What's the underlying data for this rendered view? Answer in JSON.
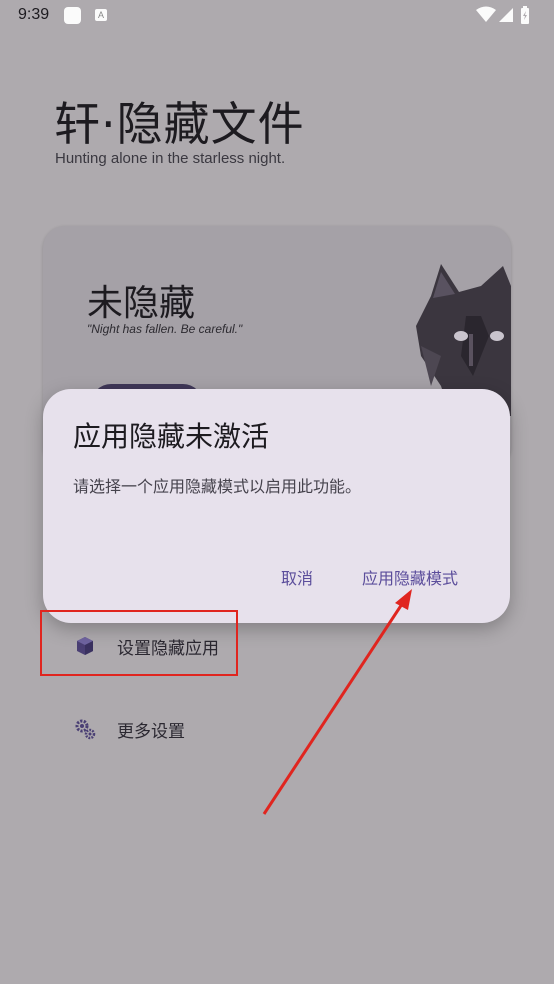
{
  "status_bar": {
    "time": "9:39",
    "notification_icon": "a-icon",
    "right_icons": [
      "wifi-icon",
      "signal-icon",
      "battery-icon"
    ]
  },
  "header": {
    "title": "轩·隐藏文件",
    "subtitle": "Hunting alone in the starless night."
  },
  "status_card": {
    "title": "未隐藏",
    "quote": "\"Night has fallen. Be careful.\""
  },
  "menu": {
    "items": [
      {
        "label": "设置隐藏应用",
        "icon": "cube-icon"
      },
      {
        "label": "更多设置",
        "icon": "gears-icon"
      }
    ]
  },
  "dialog": {
    "title": "应用隐藏未激活",
    "message": "请选择一个应用隐藏模式以启用此功能。",
    "cancel_label": "取消",
    "confirm_label": "应用隐藏模式"
  },
  "colors": {
    "background": "#aeaaae",
    "dialog_bg": "#e7e1ec",
    "accent": "#5b4d9b",
    "annotation": "#e0251f"
  }
}
